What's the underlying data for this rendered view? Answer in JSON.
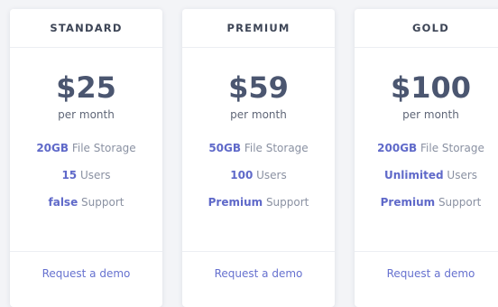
{
  "plans": [
    {
      "name": "STANDARD",
      "price": "$25",
      "period": "per month",
      "features": [
        {
          "value": "20GB",
          "label": " File Storage"
        },
        {
          "value": "15",
          "label": " Users"
        },
        {
          "value": "false",
          "label": " Support"
        }
      ],
      "cta": "Request a demo"
    },
    {
      "name": "PREMIUM",
      "price": "$59",
      "period": "per month",
      "features": [
        {
          "value": "50GB",
          "label": " File Storage"
        },
        {
          "value": "100",
          "label": " Users"
        },
        {
          "value": "Premium",
          "label": " Support"
        }
      ],
      "cta": "Request a demo"
    },
    {
      "name": "GOLD",
      "price": "$100",
      "period": "per month",
      "features": [
        {
          "value": "200GB",
          "label": " File Storage"
        },
        {
          "value": "Unlimited",
          "label": " Users"
        },
        {
          "value": "Premium",
          "label": " Support"
        }
      ],
      "cta": "Request a demo"
    }
  ],
  "colors": {
    "accent": "#5f69c9",
    "price": "#4b5670",
    "background": "#f3f4f7"
  }
}
